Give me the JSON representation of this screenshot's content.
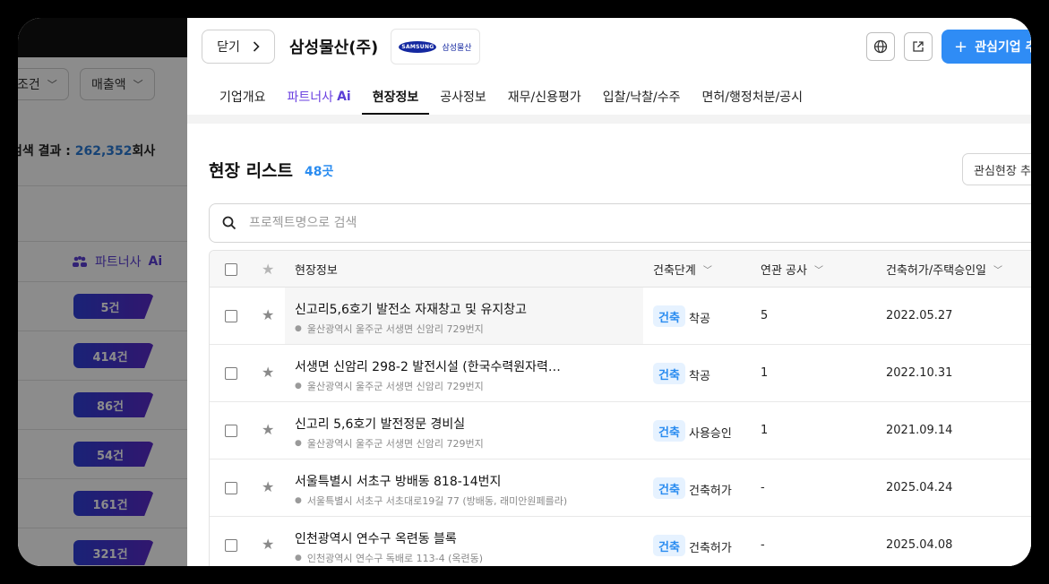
{
  "background": {
    "filters": [
      "조건",
      "매출액"
    ],
    "result_label": "검색 결과 : ",
    "result_count": "262,352",
    "result_unit": "회사",
    "column_header": {
      "label": "파트너사",
      "ai": "Ai"
    },
    "badges": [
      "5건",
      "414건",
      "86건",
      "54건",
      "161건",
      "321건"
    ]
  },
  "header": {
    "close_label": "닫기",
    "company_name": "삼성물산(주)",
    "logo": {
      "mark": "SAMSUNG",
      "text": "삼성물산"
    },
    "primary_button": "관심기업 추",
    "icons": [
      "globe-icon",
      "external-link-icon"
    ]
  },
  "tabs": [
    {
      "label": "기업개요"
    },
    {
      "label": "파트너사",
      "suffix": "Ai"
    },
    {
      "label": "현장정보",
      "active": true
    },
    {
      "label": "공사정보"
    },
    {
      "label": "재무/신용평가"
    },
    {
      "label": "입찰/낙찰/수주"
    },
    {
      "label": "면허/행정처분/공시"
    }
  ],
  "list": {
    "title": "현장 리스트",
    "count": "48곳",
    "watch_button": "관심현장 추",
    "search_placeholder": "프로젝트명으로 검색",
    "columns": {
      "site_info": "현장정보",
      "stage": "건축단계",
      "related": "연관 공사",
      "permit_date": "건축허가/주택승인일"
    },
    "rows": [
      {
        "name": "신고리5,6호기 발전소 자재창고 및 유지창고",
        "address": "울산광역시 울주군 서생면 신암리 729번지",
        "badge": "건축",
        "stage": "착공",
        "related": "5",
        "date": "2022.05.27"
      },
      {
        "name": "서생면 신암리 298-2 발전시설 (한국수력원자력(…",
        "address": "울산광역시 울주군 서생면 신암리 729번지",
        "badge": "건축",
        "stage": "착공",
        "related": "1",
        "date": "2022.10.31"
      },
      {
        "name": "신고리 5,6호기 발전정문 경비실",
        "address": "울산광역시 울주군 서생면 신암리 729번지",
        "badge": "건축",
        "stage": "사용승인",
        "related": "1",
        "date": "2021.09.14"
      },
      {
        "name": "서울특별시 서초구 방배동 818-14번지",
        "address": "서울특별시 서초구 서초대로19길 77 (방배동, 래미안원페를라)",
        "badge": "건축",
        "stage": "건축허가",
        "related": "-",
        "date": "2025.04.24"
      },
      {
        "name": "인천광역시 연수구 옥련동 블록",
        "address": "인천광역시 연수구 독배로 113-4 (옥련동)",
        "badge": "건축",
        "stage": "건축허가",
        "related": "-",
        "date": "2025.04.08"
      }
    ]
  }
}
